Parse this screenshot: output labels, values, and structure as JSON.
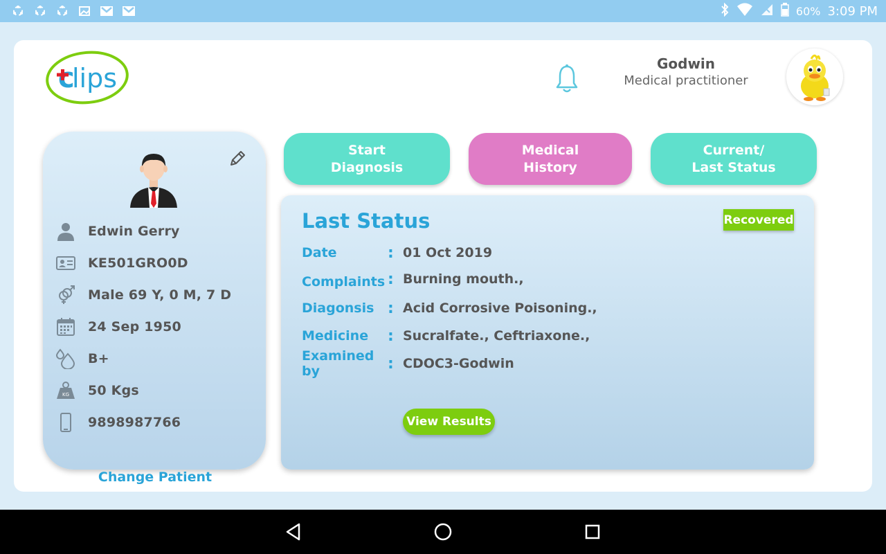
{
  "status_bar": {
    "battery": "60%",
    "time": "3:09 PM",
    "left_icons": [
      "sync-icon",
      "sync-icon",
      "sync-icon",
      "image-icon",
      "gmail-icon",
      "gmail-icon"
    ],
    "right_icons": [
      "bluetooth-icon",
      "wifi-icon",
      "sim-icon",
      "battery-icon"
    ]
  },
  "header": {
    "logo_text": "lips",
    "user_name": "Godwin",
    "user_role": "Medical practitioner"
  },
  "patient": {
    "name": "Edwin Gerry",
    "id": "KE501GRO0D",
    "gender_age": "Male 69 Y, 0 M, 7 D",
    "dob": "24 Sep 1950",
    "blood_group": "B+",
    "weight": "50 Kgs",
    "phone": "9898987766",
    "change_label": "Change Patient"
  },
  "tabs": [
    {
      "label": "Start\nDiagnosis"
    },
    {
      "label": "Medical\nHistory"
    },
    {
      "label": "Current/\nLast Status"
    }
  ],
  "last_status": {
    "title": "Last Status",
    "badge": "Recovered",
    "rows": [
      {
        "label": "Date",
        "value": "01 Oct 2019"
      },
      {
        "label": "Complaints",
        "value": "Burning mouth.,"
      },
      {
        "label": "Diagonsis",
        "value": "Acid Corrosive Poisoning.,"
      },
      {
        "label": "Medicine",
        "value": "Sucralfate., Ceftriaxone.,"
      },
      {
        "label": "Examined by",
        "value": "CDOC3-Godwin"
      }
    ],
    "colon": ":",
    "view_button": "View Results"
  },
  "colors": {
    "accent_blue": "#2aa4d8",
    "teal": "#5fe0cc",
    "pink": "#e07cc6",
    "green": "#7dcd0f",
    "status_bar": "#92ccf0"
  }
}
